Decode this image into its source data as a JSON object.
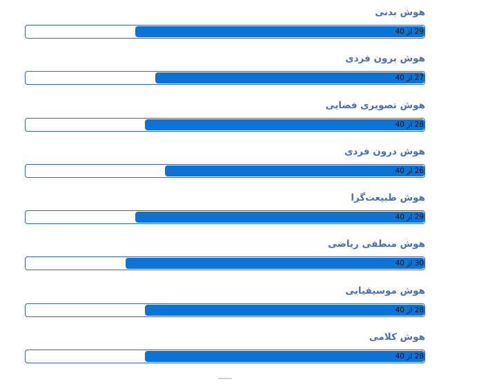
{
  "results": [
    {
      "label": "هوش بدنی",
      "score": 29,
      "max": 40,
      "score_text": "29 از 40"
    },
    {
      "label": "هوش برون فردی",
      "score": 27,
      "max": 40,
      "score_text": "27 از 40"
    },
    {
      "label": "هوش تصویری فضایی",
      "score": 28,
      "max": 40,
      "score_text": "28 از 40"
    },
    {
      "label": "هوش درون فردی",
      "score": 26,
      "max": 40,
      "score_text": "26 از 40"
    },
    {
      "label": "هوش طبیعت‌گرا",
      "score": 29,
      "max": 40,
      "score_text": "29 از 40"
    },
    {
      "label": "هوش منطقی ریاضی",
      "score": 30,
      "max": 40,
      "score_text": "30 از 40"
    },
    {
      "label": "هوش موسیقیایی",
      "score": 28,
      "max": 40,
      "score_text": "28 از 40"
    },
    {
      "label": "هوش کلامی",
      "score": 28,
      "max": 40,
      "score_text": "28 از 40"
    }
  ],
  "colors": {
    "label": "#4a6fb5",
    "fill": "#0a74d6",
    "border": "#3a64a8"
  }
}
